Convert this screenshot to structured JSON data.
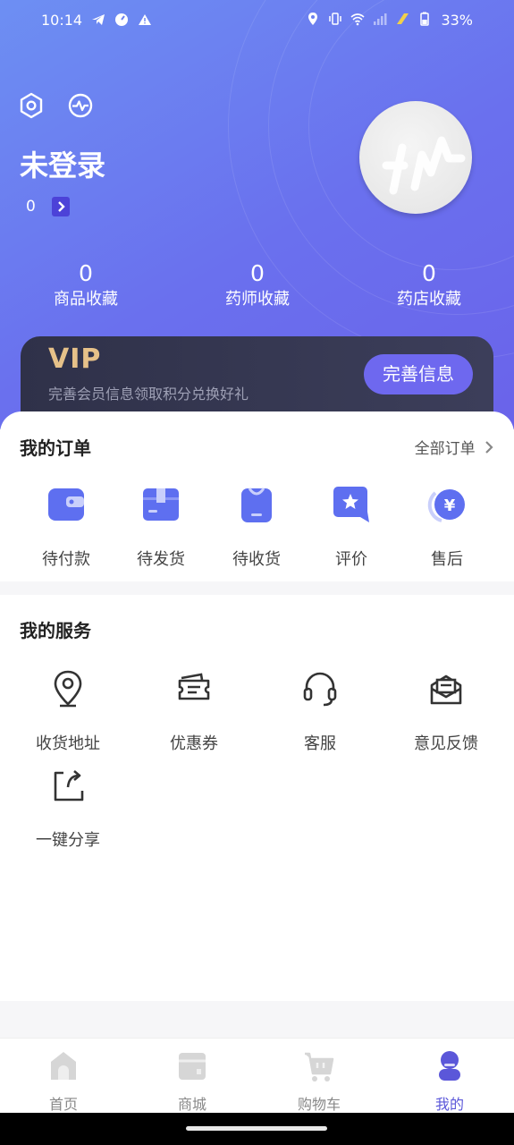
{
  "status_bar": {
    "time": "10:14",
    "battery": "33%",
    "left_icons": [
      "telegram-icon",
      "speed-icon",
      "alert-icon"
    ],
    "right_icons": [
      "location-icon",
      "vibrate-icon",
      "wifi-icon",
      "signal-icon",
      "charging-icon",
      "battery-icon"
    ]
  },
  "header": {
    "title": "未登录",
    "points": "0",
    "icons": [
      "settings-icon",
      "message-icon"
    ]
  },
  "stats": [
    {
      "value": "0",
      "label": "商品收藏"
    },
    {
      "value": "0",
      "label": "药师收藏"
    },
    {
      "value": "0",
      "label": "药店收藏"
    }
  ],
  "vip": {
    "title": "VIP",
    "subtitle": "完善会员信息领取积分兑换好礼",
    "button": "完善信息"
  },
  "orders": {
    "title": "我的订单",
    "all_link": "全部订单",
    "items": [
      {
        "label": "待付款",
        "icon": "wallet-icon"
      },
      {
        "label": "待发货",
        "icon": "box-icon"
      },
      {
        "label": "待收货",
        "icon": "bag-icon"
      },
      {
        "label": "评价",
        "icon": "review-icon"
      },
      {
        "label": "售后",
        "icon": "after-sales-icon"
      }
    ]
  },
  "services": {
    "title": "我的服务",
    "items": [
      {
        "label": "收货地址",
        "icon": "location-pin-icon"
      },
      {
        "label": "优惠券",
        "icon": "coupon-icon"
      },
      {
        "label": "客服",
        "icon": "headset-icon"
      },
      {
        "label": "意见反馈",
        "icon": "feedback-mail-icon"
      },
      {
        "label": "一键分享",
        "icon": "share-icon"
      }
    ]
  },
  "tabbar": {
    "items": [
      {
        "label": "首页",
        "icon": "home-icon"
      },
      {
        "label": "商城",
        "icon": "shop-icon"
      },
      {
        "label": "购物车",
        "icon": "cart-icon"
      },
      {
        "label": "我的",
        "icon": "profile-icon"
      }
    ],
    "active_color": "#5b57d9"
  },
  "colors": {
    "accent": "#6e68ef",
    "order_icon": "#5e6ff0",
    "vip_gold": "#e6c189"
  }
}
